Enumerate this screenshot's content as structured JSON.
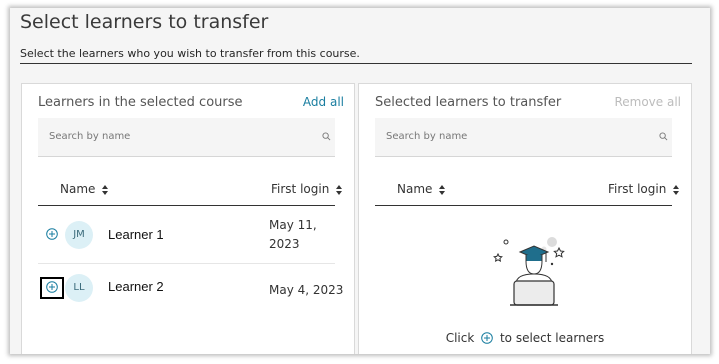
{
  "page": {
    "title": "Select learners to transfer",
    "subtitle": "Select the learners who you wish to transfer from this course."
  },
  "left_panel": {
    "title": "Learners in the selected course",
    "action_label": "Add all",
    "search": {
      "placeholder": "Search by name"
    },
    "columns": {
      "name": "Name",
      "first_login": "First login"
    },
    "rows": [
      {
        "initials": "JM",
        "name": "Learner 1",
        "first_login_line1": "May 11,",
        "first_login_line2": "2023"
      },
      {
        "initials": "LL",
        "name": "Learner 2",
        "first_login": "May 4, 2023"
      }
    ]
  },
  "right_panel": {
    "title": "Selected learners to transfer",
    "action_label": "Remove all",
    "search": {
      "placeholder": "Search by name"
    },
    "columns": {
      "name": "Name",
      "first_login": "First login"
    },
    "empty_state": {
      "before": "Click",
      "after": "to select learners"
    }
  },
  "icons": {
    "add": "plus-circle-icon",
    "sort": "sort-arrows-icon",
    "search": "search-icon",
    "empty_illustration": "graduate-laptop-illustration"
  },
  "colors": {
    "accent": "#1a7ea0",
    "disabled": "#bcbcbc",
    "avatar_bg": "#dcf0f6",
    "focus_outline": "#000000"
  }
}
